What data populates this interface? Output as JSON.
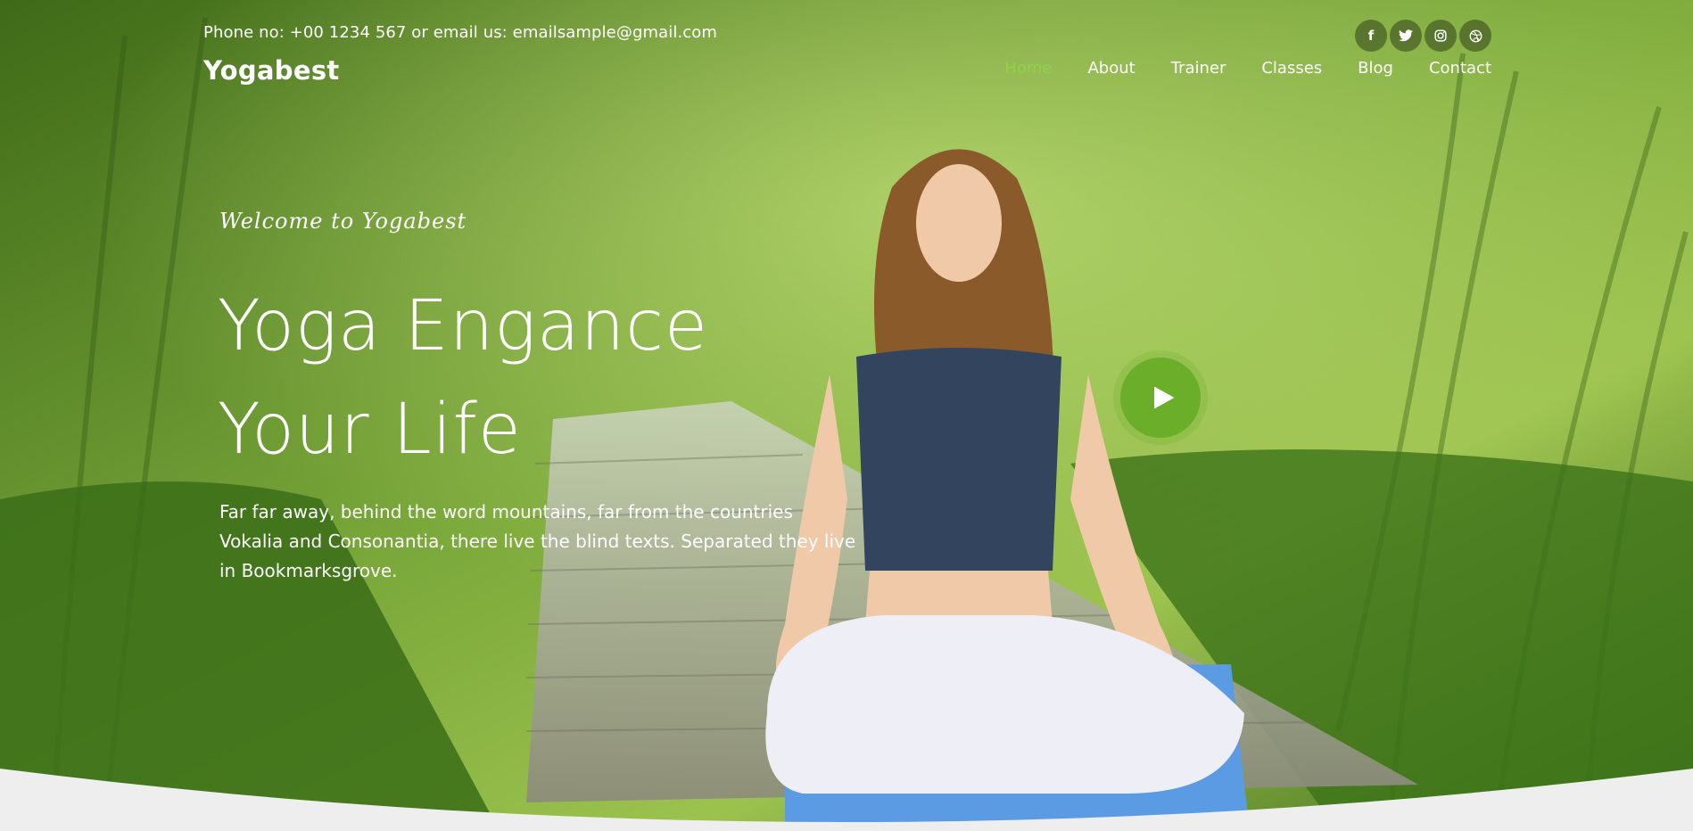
{
  "topbar": {
    "contact": "Phone no: +00 1234 567 or email us: emailsample@gmail.com",
    "social": [
      {
        "icon": "facebook-icon",
        "glyph": "f"
      },
      {
        "icon": "twitter-icon",
        "glyph": "t"
      },
      {
        "icon": "instagram-icon",
        "glyph": "◎"
      },
      {
        "icon": "dribbble-icon",
        "glyph": "⊛"
      }
    ]
  },
  "navbar": {
    "brand": "Yogabest",
    "items": [
      {
        "label": "Home",
        "active": true
      },
      {
        "label": "About",
        "active": false
      },
      {
        "label": "Trainer",
        "active": false
      },
      {
        "label": "Classes",
        "active": false
      },
      {
        "label": "Blog",
        "active": false
      },
      {
        "label": "Contact",
        "active": false
      }
    ]
  },
  "hero": {
    "welcome": "Welcome to Yogabest",
    "headline_line1": "Yoga Engance",
    "headline_line2": "Your Life",
    "blurb": "Far far away, behind the word mountains, far from the countries Vokalia and Consonantia, there live the blind texts. Separated they live in Bookmarksgrove.",
    "play_icon": "play-icon"
  },
  "colors": {
    "accent": "#8fd14a",
    "play_button": "#6aae2a",
    "section_bg": "#eeeeee"
  }
}
